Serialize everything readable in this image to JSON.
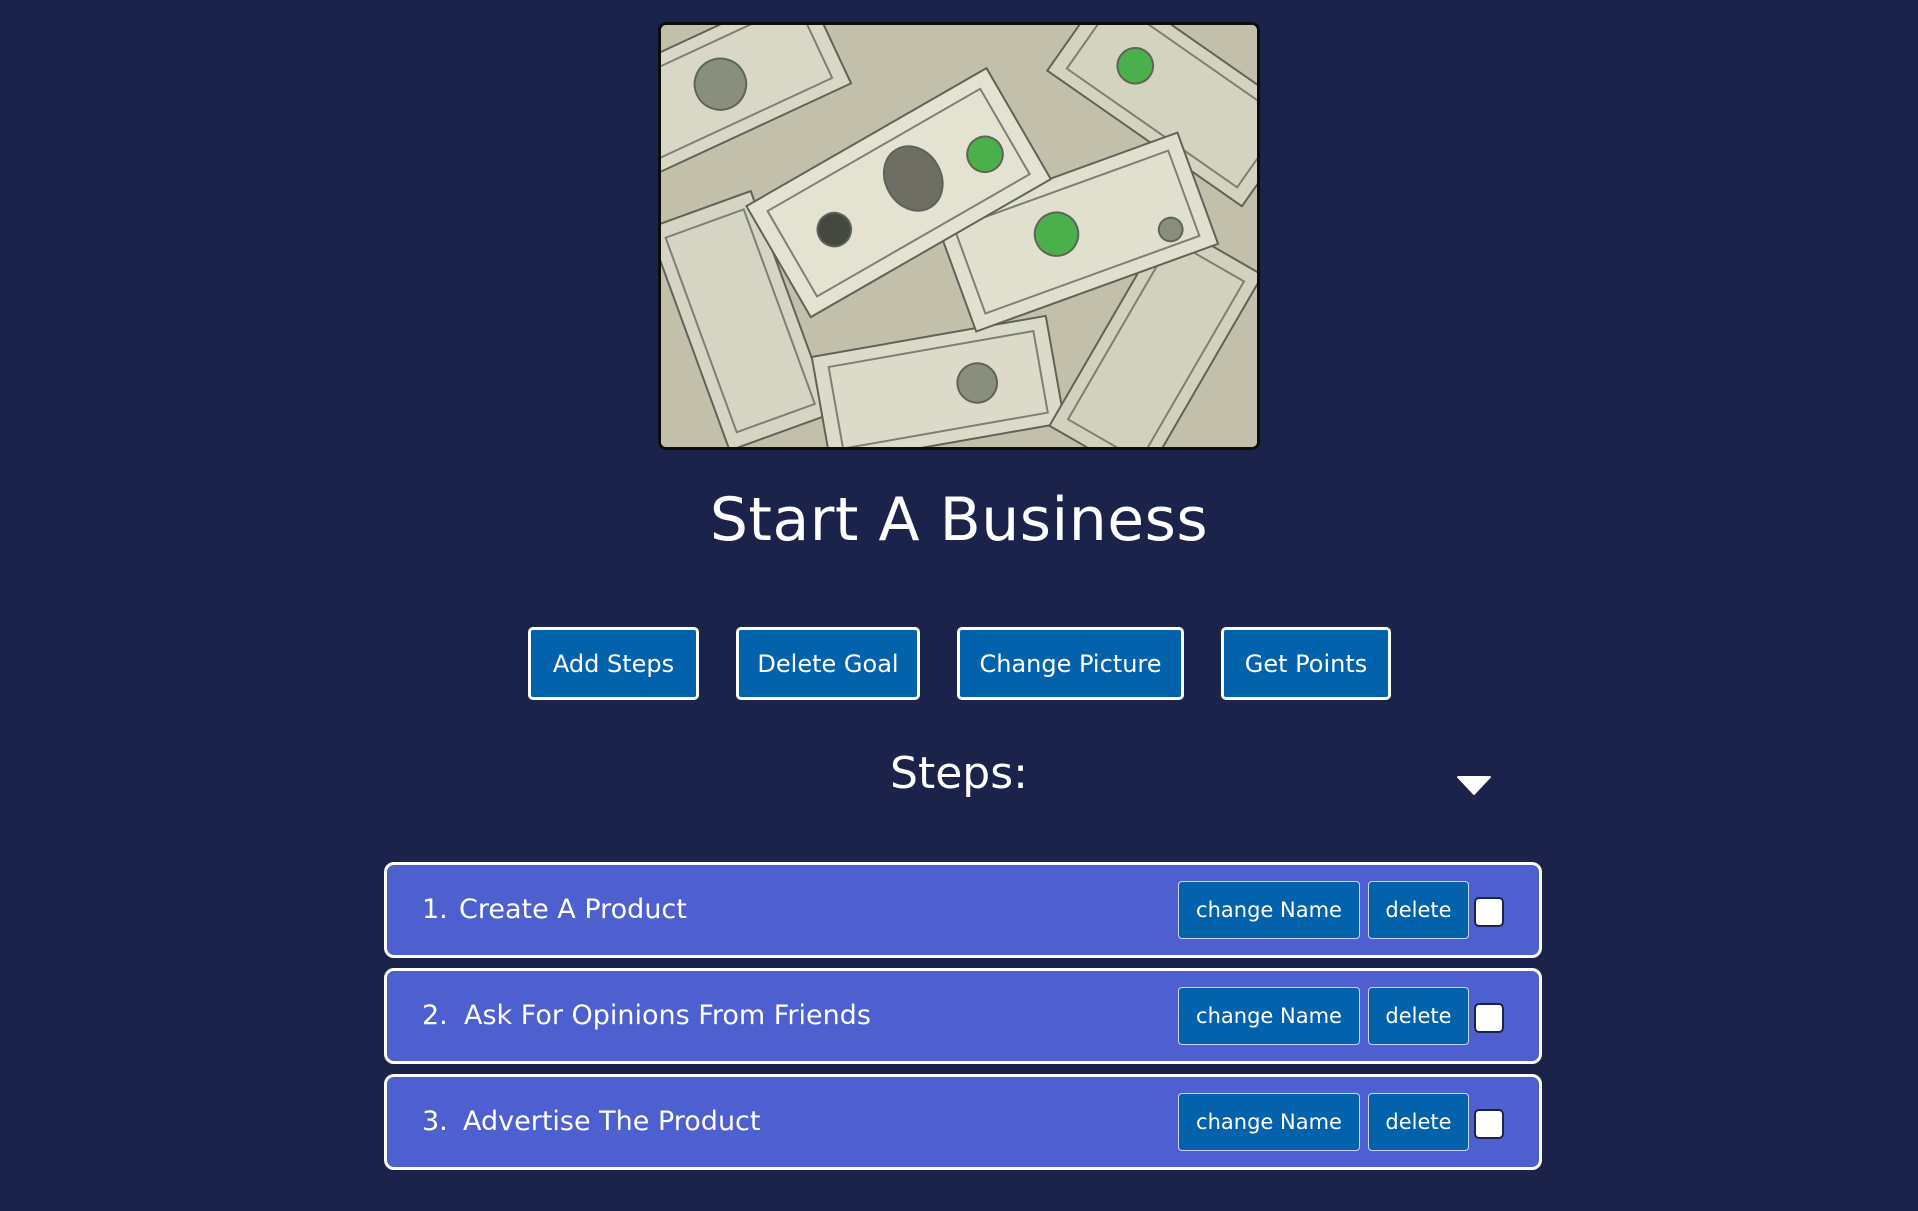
{
  "goal": {
    "title": "Start A Business",
    "image_icon": "money-banknotes-image"
  },
  "actions": {
    "add_steps": "Add Steps",
    "delete_goal": "Delete Goal",
    "change_picture": "Change Picture",
    "get_points": "Get Points"
  },
  "steps_section": {
    "heading": "Steps:",
    "toggle_icon": "caret-down-icon"
  },
  "steps": [
    {
      "number": "1.",
      "name": "Create A Product",
      "rename_label": "change Name",
      "delete_label": "delete",
      "checked": false
    },
    {
      "number": "2.",
      "name": "Ask For Opinions From Friends",
      "rename_label": "change Name",
      "delete_label": "delete",
      "checked": false
    },
    {
      "number": "3.",
      "name": "Advertise The Product",
      "rename_label": "change Name",
      "delete_label": "delete",
      "checked": false
    }
  ],
  "colors": {
    "background": "#1c234b",
    "step_row": "#4e5fcf",
    "button": "#0362ac",
    "text": "#ffffff"
  }
}
